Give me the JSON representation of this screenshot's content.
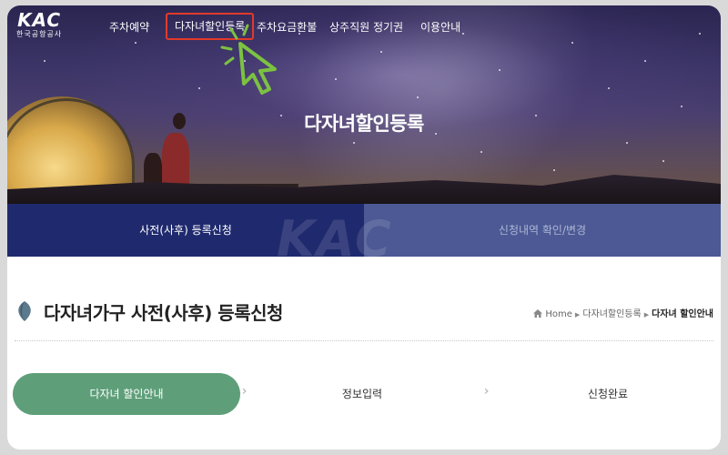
{
  "logo": {
    "mark": "KAC",
    "subtitle": "한국공항공사"
  },
  "nav": {
    "items": [
      {
        "label": "주차예약"
      },
      {
        "label": "다자녀할인등록",
        "active": true
      },
      {
        "label": "주차요금환불"
      },
      {
        "label": "상주직원 정기권"
      },
      {
        "label": "이용안내"
      }
    ],
    "highlight_color": "#e23a2a"
  },
  "hero": {
    "title": "다자녀할인등록"
  },
  "tabs": {
    "items": [
      {
        "label": "사전(사후) 등록신청",
        "active": true
      },
      {
        "label": "신청내역 확인/변경",
        "active": false
      }
    ],
    "watermark": "KAC",
    "active_color": "#1f2a6e",
    "inactive_color": "#4c5994"
  },
  "section": {
    "title": "다자녀가구 사전(사후) 등록신청",
    "breadcrumb": [
      "Home",
      "다자녀할인등록",
      "다자녀 할인안내"
    ]
  },
  "steps": {
    "items": [
      {
        "label": "다자녀 할인안내",
        "active": true
      },
      {
        "label": "정보입력",
        "active": false
      },
      {
        "label": "신청완료",
        "active": false
      }
    ],
    "active_color": "#5e9f7a"
  },
  "cursor": {
    "color": "#7cc241"
  }
}
